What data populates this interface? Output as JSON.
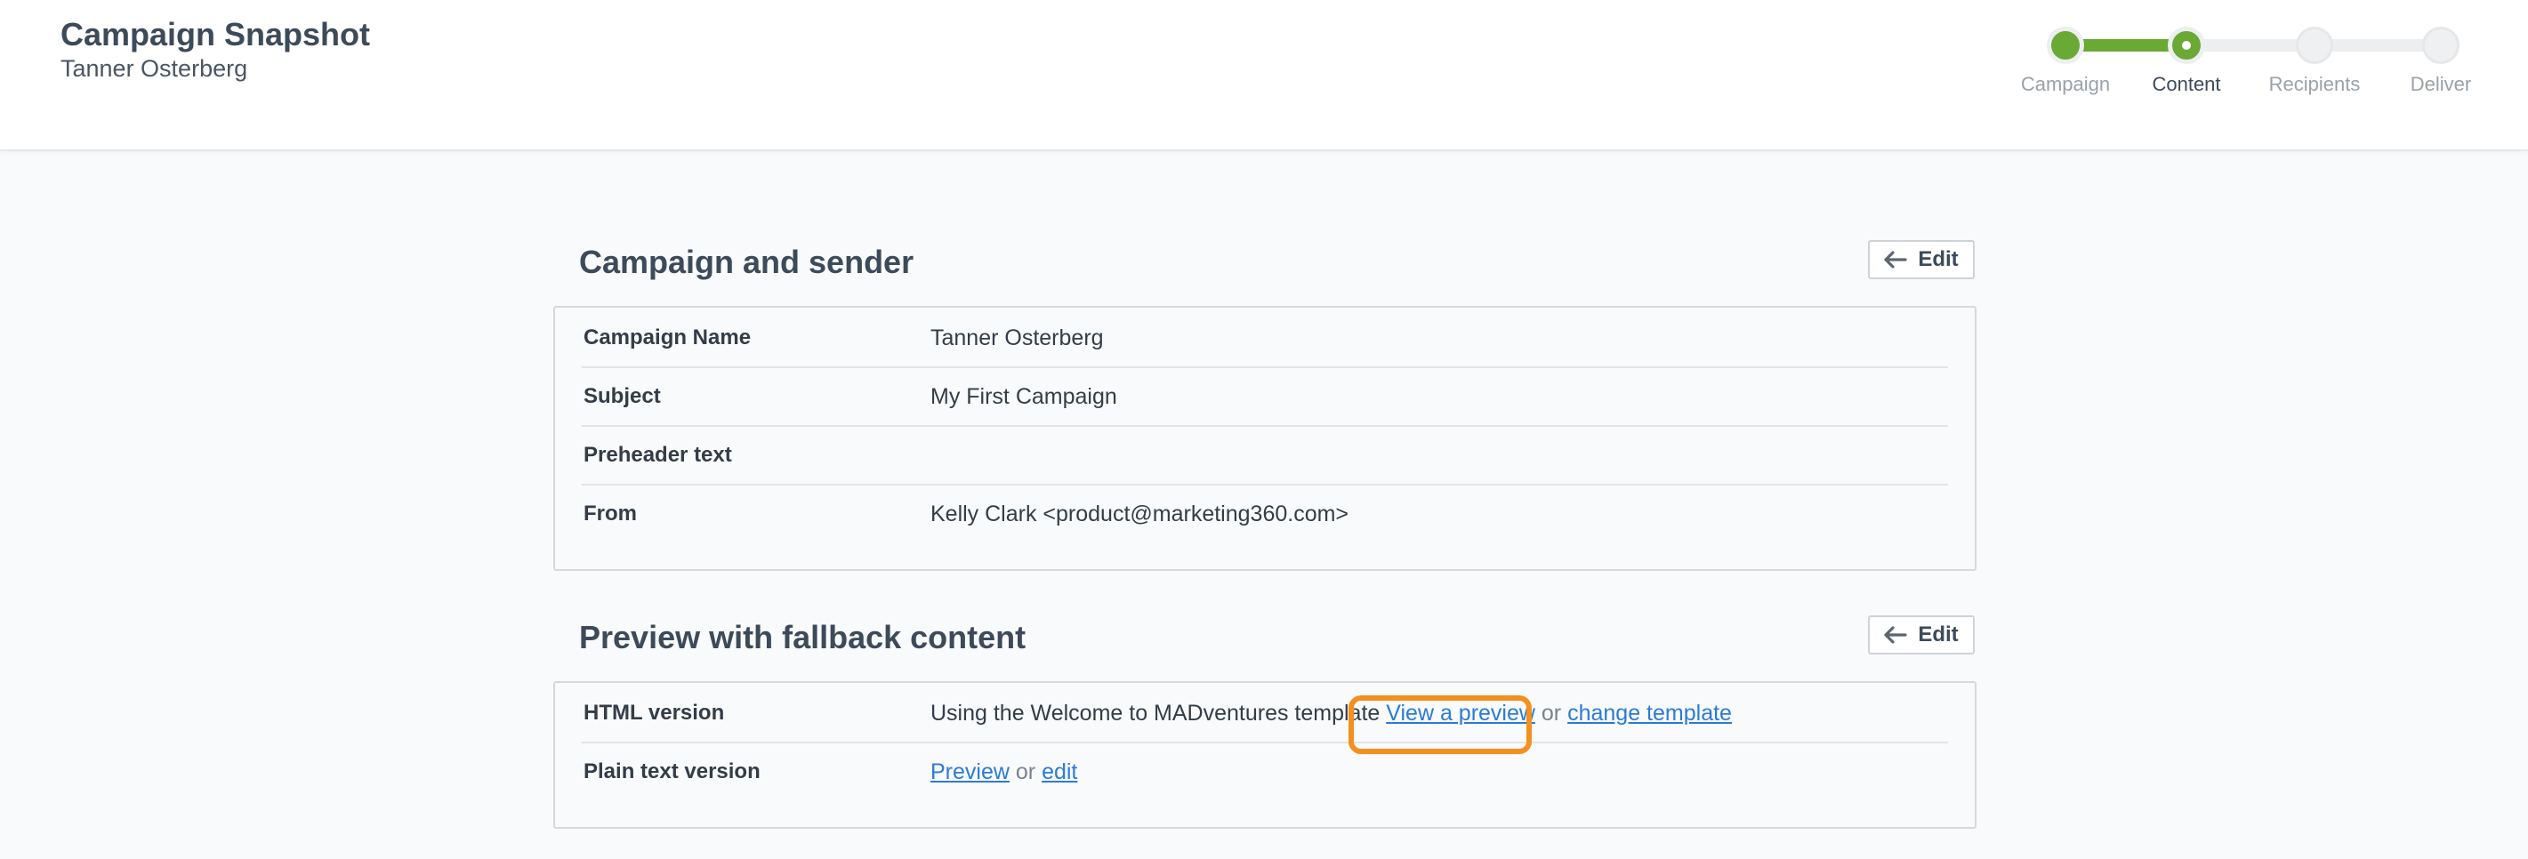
{
  "header": {
    "title": "Campaign Snapshot",
    "subtitle": "Tanner Osterberg"
  },
  "stepper": {
    "steps": [
      {
        "label": "Campaign",
        "state": "done"
      },
      {
        "label": "Content",
        "state": "current"
      },
      {
        "label": "Recipients",
        "state": "pending"
      },
      {
        "label": "Deliver",
        "state": "pending"
      }
    ],
    "accent_color": "#6aa934"
  },
  "campaign_section": {
    "title": "Campaign and sender",
    "edit_label": "Edit",
    "rows": [
      {
        "label": "Campaign Name",
        "value": "Tanner Osterberg"
      },
      {
        "label": "Subject",
        "value": "My First Campaign"
      },
      {
        "label": "Preheader text",
        "value": ""
      },
      {
        "label": "From",
        "value": "Kelly Clark <product@marketing360.com>"
      }
    ]
  },
  "preview_section": {
    "title": "Preview with fallback content",
    "edit_label": "Edit",
    "html_row": {
      "label": "HTML version",
      "text": "Using the Welcome to MADventures template",
      "preview_link": "View a preview",
      "or": "or",
      "change_link": "change template"
    },
    "plain_row": {
      "label": "Plain text version",
      "preview_link": "Preview",
      "or": "or",
      "edit_link": "edit"
    }
  },
  "colors": {
    "link": "#2b7bd6",
    "highlight": "#f3901f",
    "title": "#3d4a5a"
  }
}
